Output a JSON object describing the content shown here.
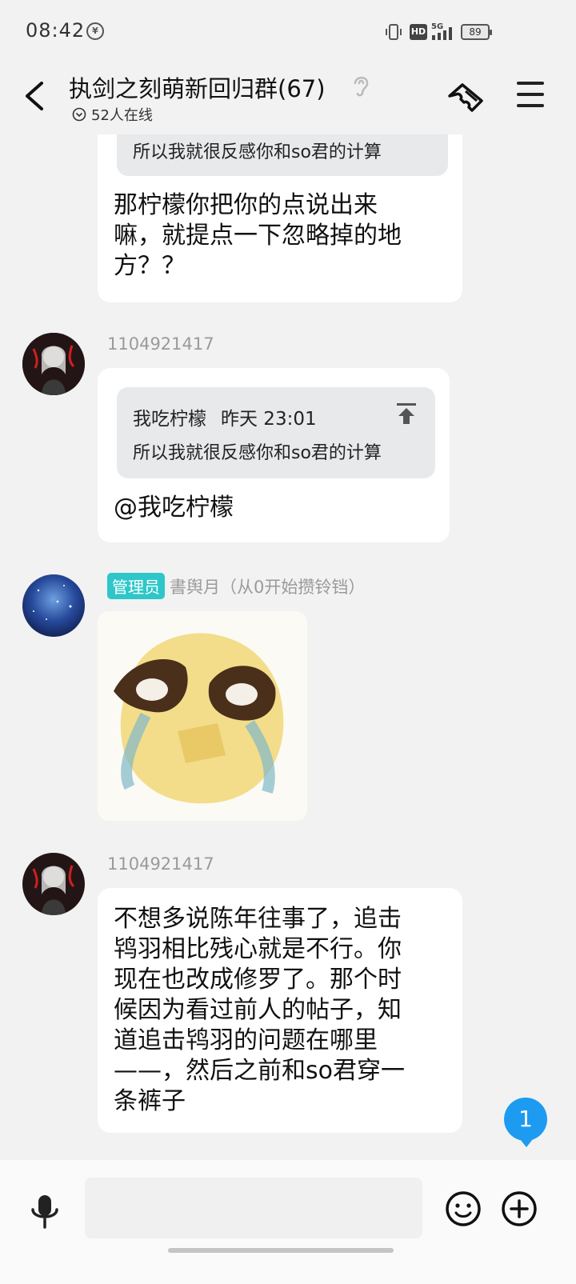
{
  "status_bar": {
    "time": "08:42",
    "battery": "89",
    "network": "5G",
    "hd": "HD"
  },
  "header": {
    "title": "执剑之刻萌新回归群(67)",
    "online": "52人在线"
  },
  "messages": [
    {
      "quote_text": "所以我就很反感你和so君的计算",
      "text_lines": [
        "那柠檬你把你的点说出来",
        "嘛，就提点一下忽略掉的地",
        "方？？"
      ]
    },
    {
      "sender": "1104921417",
      "quote_author": "我吃柠檬",
      "quote_time": "昨天 23:01",
      "quote_text": "所以我就很反感你和so君的计算",
      "text": "@我吃柠檬"
    },
    {
      "role": "管理员",
      "sender": "書舆月（从0开始攒铃铛）",
      "image": "crying-emoji-sticker"
    },
    {
      "sender": "1104921417",
      "text_lines": [
        "不想多说陈年往事了，追击",
        "鸨羽相比残心就是不行。你",
        "现在也改成修罗了。那个时",
        "候因为看过前人的帖子，知",
        "道追击鸨羽的问题在哪里",
        "——，然后之前和so君穿一",
        "条裤子"
      ]
    }
  ],
  "unread_count": "1",
  "input": {
    "placeholder": ""
  },
  "colors": {
    "accent": "#1d9bf0",
    "admin_badge": "#2ec7c9"
  }
}
